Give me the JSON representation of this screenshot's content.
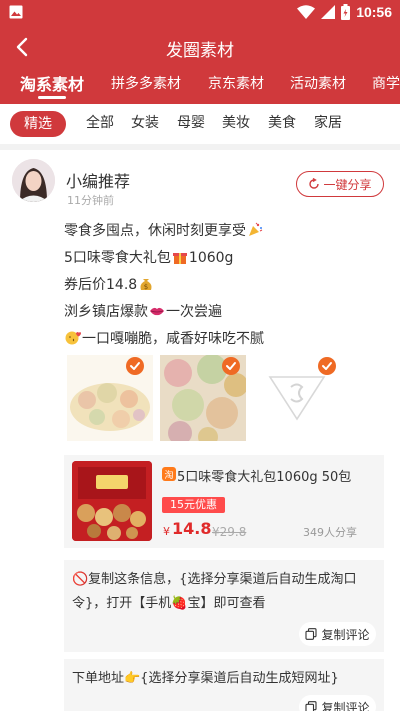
{
  "status_bar": {
    "time": "10:56",
    "left_icon": "image-icon",
    "right_icons": [
      "wifi-icon",
      "signal-icon",
      "battery-icon"
    ]
  },
  "app_bar": {
    "title": "发圈素材",
    "back_icon": "back-arrow-icon"
  },
  "tabs": [
    {
      "label": "淘系素材",
      "active": true
    },
    {
      "label": "拼多多素材",
      "active": false
    },
    {
      "label": "京东素材",
      "active": false
    },
    {
      "label": "活动素材",
      "active": false
    },
    {
      "label": "商学",
      "active": false
    }
  ],
  "filters": [
    "精选",
    "全部",
    "女装",
    "母婴",
    "美妆",
    "美食",
    "家居"
  ],
  "post": {
    "author": "小编推荐",
    "time_ago": "11分钟前",
    "share_button": "一键分享",
    "lines": [
      {
        "text": "零食多囤点，休闲时刻更享受",
        "emoji_after": "party-popper-icon"
      },
      {
        "text_before": "5口味零食大礼包",
        "emoji": "gift-icon",
        "text_after": "1060g"
      },
      {
        "text": "券后价14.8",
        "emoji_after": "money-bag-icon"
      },
      {
        "text_before": "浏乡镇店爆款",
        "emoji": "lips-icon",
        "text_after": "一次尝遍"
      },
      {
        "emoji_before": "blowing-kiss-icon",
        "text": "一口嘎嘣脆，咸香好味吃不腻"
      }
    ],
    "thumbnails": [
      "snack-assortment-thumb",
      "snack-closeup-thumb",
      "brand-logo-thumb"
    ]
  },
  "product": {
    "platform_badge": "taobao-badge-icon",
    "title": "5口味零食大礼包1060g 50包",
    "coupon": "15元优惠",
    "price_symbol": "¥",
    "price": "14.8",
    "original_price": "¥29.8",
    "share_count": "349人分享"
  },
  "comments": [
    {
      "text": "🚫复制这条信息，{选择分享渠道后自动生成淘口令}，打开【手机🍓宝】即可查看",
      "button": "复制评论"
    },
    {
      "text": "下单地址👉{选择分享渠道后自动生成短网址}",
      "button": "复制评论"
    }
  ],
  "colors": {
    "brand_red": "#d0393c",
    "coupon_red": "#ff4b4b",
    "price_red": "#e02a2a",
    "check_orange": "#ef6a24"
  }
}
